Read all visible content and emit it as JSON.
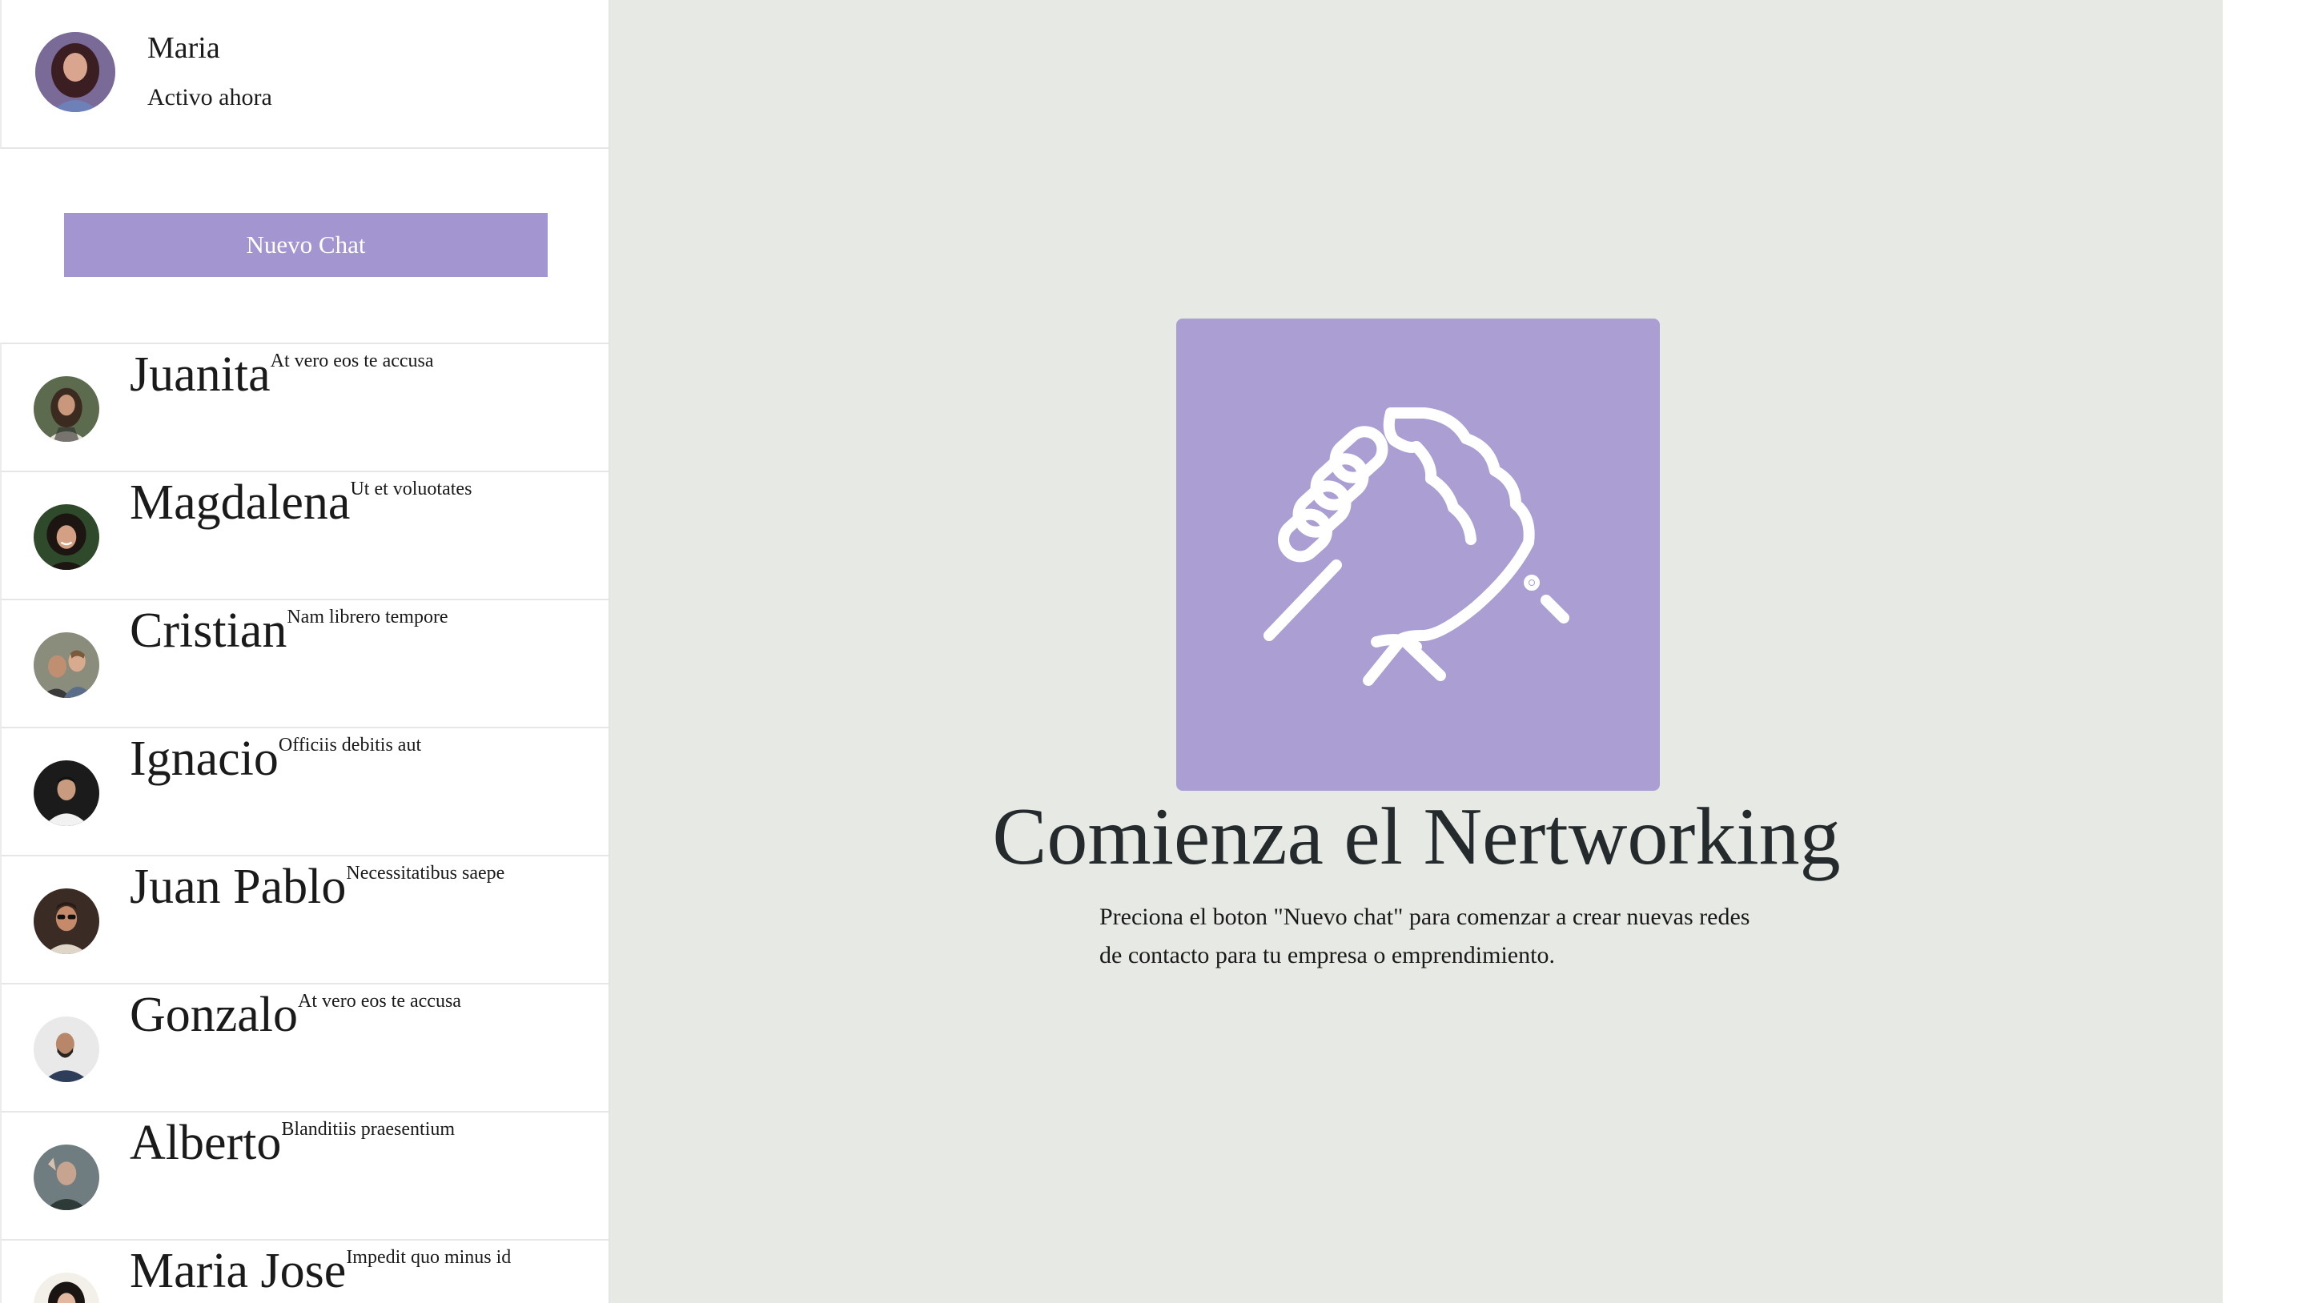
{
  "profile": {
    "name": "Maria",
    "status": "Activo ahora"
  },
  "sidebar": {
    "new_chat_label": "Nuevo Chat",
    "contacts": [
      {
        "name": "Juanita",
        "preview": "At vero eos te accusa"
      },
      {
        "name": "Magdalena",
        "preview": "Ut et voluotates"
      },
      {
        "name": "Cristian",
        "preview": "Nam librero tempore"
      },
      {
        "name": "Ignacio",
        "preview": "Officiis debitis aut"
      },
      {
        "name": "Juan Pablo",
        "preview": "Necessitatibus saepe"
      },
      {
        "name": "Gonzalo",
        "preview": "At vero eos te accusa"
      },
      {
        "name": "Alberto",
        "preview": "Blanditiis praesentium"
      },
      {
        "name": "Maria Jose",
        "preview": "Impedit quo minus id"
      }
    ]
  },
  "main": {
    "hero_icon": "handshake-icon",
    "title": "Comienza el Nertworking",
    "description": "Preciona el boton \"Nuevo chat\" para comenzar a crear nuevas redes de contacto para tu empresa o emprendimiento."
  },
  "colors": {
    "accent": "#a395d0",
    "hero_box": "#aa9ed3",
    "main_background": "#e7e9e4"
  }
}
